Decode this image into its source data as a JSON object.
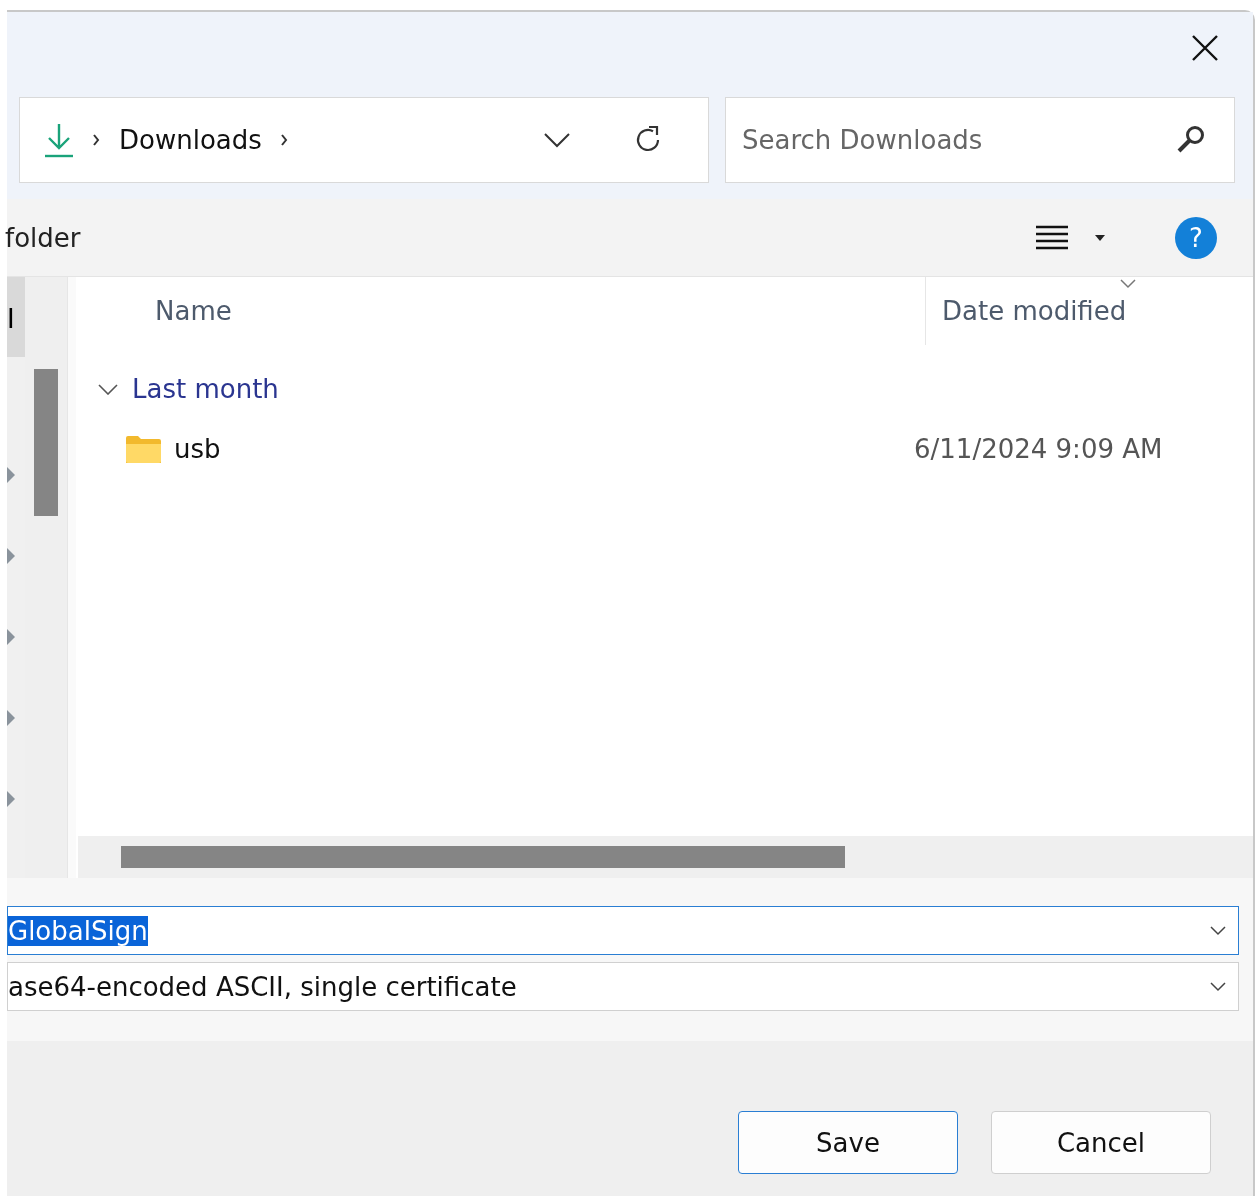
{
  "address_bar": {
    "breadcrumbs": [
      "Downloads"
    ]
  },
  "search": {
    "placeholder": "Search Downloads"
  },
  "toolbar": {
    "new_folder": "folder",
    "help": "?"
  },
  "sidebar": {
    "label": "I",
    "items": [
      {
        "expanded": false
      },
      {
        "expanded": false
      },
      {
        "expanded": false
      },
      {
        "expanded": false
      },
      {
        "expanded": false
      }
    ]
  },
  "columns": [
    {
      "label": "Name",
      "sorted": false
    },
    {
      "label": "Date modified",
      "sorted": true
    }
  ],
  "groups": [
    {
      "label": "Last month",
      "expanded": true,
      "rows": [
        {
          "name": "usb",
          "kind": "folder",
          "date": "6/11/2024 9:09 AM"
        }
      ]
    }
  ],
  "file_name": {
    "value": "GlobalSign",
    "selected": true
  },
  "file_type": {
    "value": "ase64-encoded ASCII, single certificate"
  },
  "buttons": [
    {
      "label": "Save",
      "default": true
    },
    {
      "label": "Cancel",
      "default": false
    }
  ]
}
